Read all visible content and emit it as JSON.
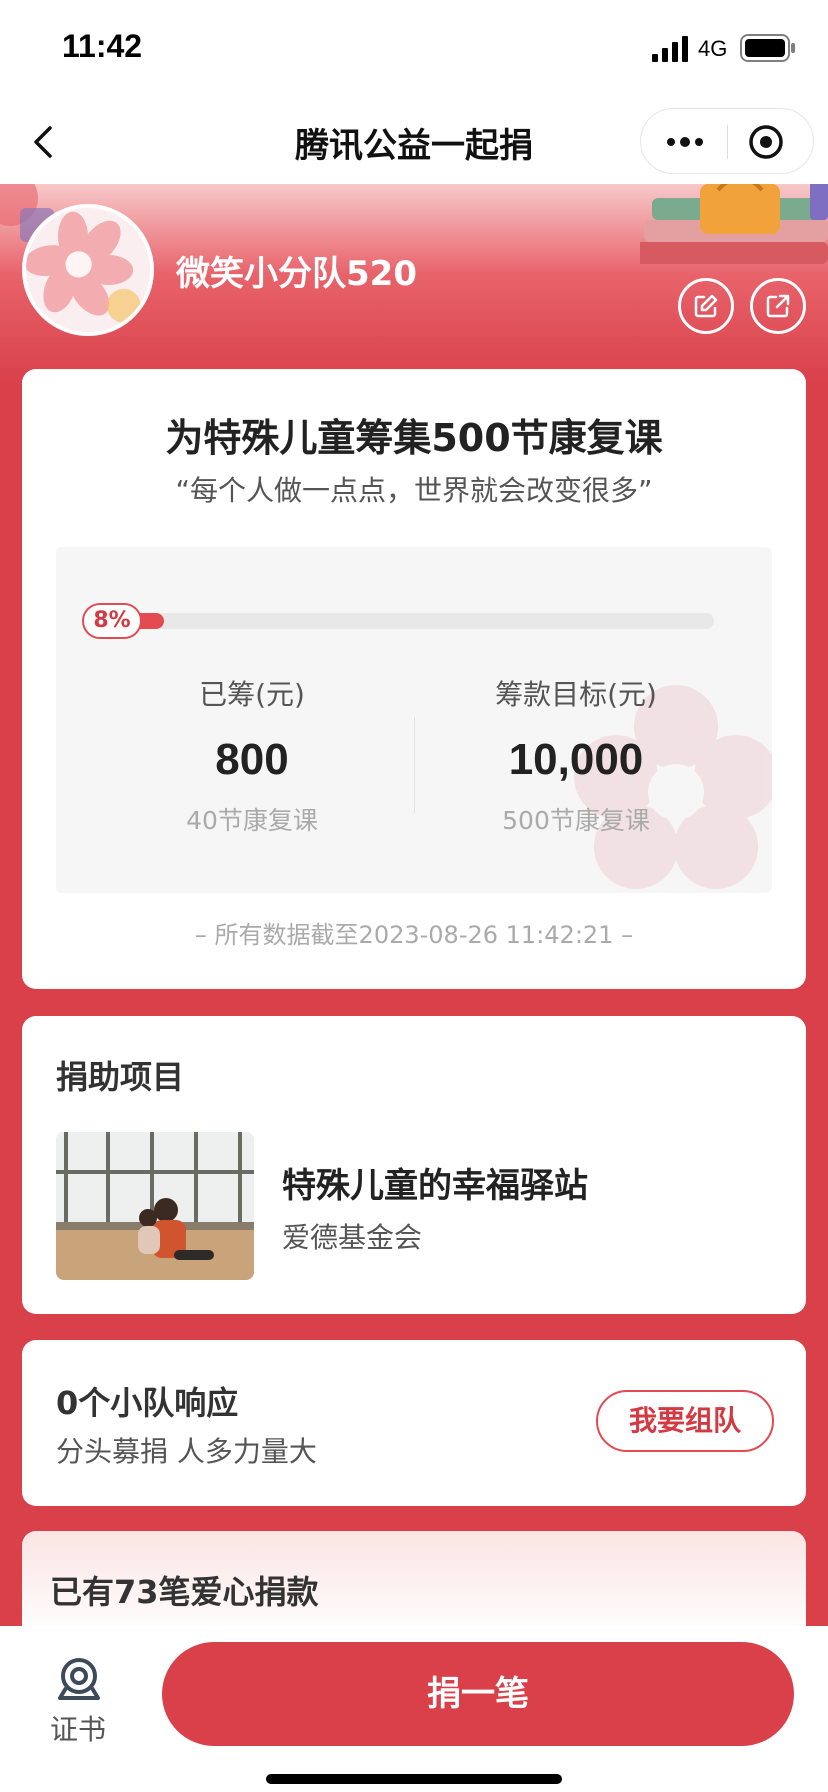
{
  "status_bar": {
    "time": "11:42",
    "network": "4G"
  },
  "nav": {
    "title": "腾讯公益一起捐"
  },
  "header": {
    "team_name": "微笑小分队520"
  },
  "campaign": {
    "title": "为特殊儿童筹集500节康复课",
    "slogan": "“每个人做一点点，世界就会改变很多”",
    "progress_percent": 8,
    "progress_label": "8%",
    "raised_label": "已筹(元)",
    "raised_value": "800",
    "raised_sub": "40节康复课",
    "goal_label": "筹款目标(元)",
    "goal_value": "10,000",
    "goal_sub": "500节康复课",
    "data_time": "– 所有数据截至2023-08-26 11:42:21 –"
  },
  "project": {
    "section_title": "捐助项目",
    "name": "特殊儿童的幸福驿站",
    "org": "爱德基金会"
  },
  "team": {
    "count": "0个小队响应",
    "slogan": "分头募捐  人多力量大",
    "button": "我要组队"
  },
  "donations": {
    "count": "已有73笔爱心捐款"
  },
  "bottom_bar": {
    "certificate_label": "证书",
    "donate_button": "捐一笔"
  },
  "colors": {
    "accent": "#d9404a",
    "accent_text": "#d33a42"
  }
}
